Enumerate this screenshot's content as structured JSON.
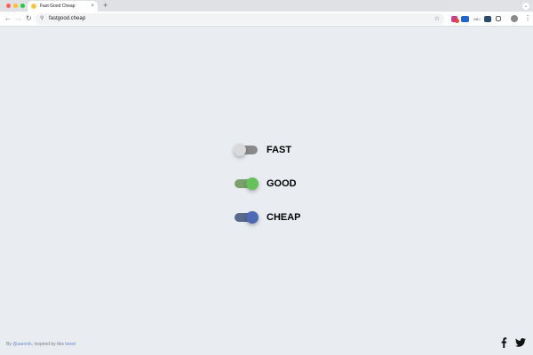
{
  "browser": {
    "tab": {
      "title": "Fast Good Cheap",
      "close_glyph": "×",
      "favicon": "smiley-face-favicon"
    },
    "new_tab_glyph": "+",
    "tab_menu_glyph": "⌄",
    "toolbar": {
      "back_glyph": "←",
      "forward_glyph": "→",
      "reload_glyph": "↻",
      "site_info_glyph": "⚲",
      "url": "fastgood.cheap",
      "bookmark_glyph": "☆",
      "ext_3_text": "ABC",
      "kebab_glyph": "⋮"
    }
  },
  "toggles": [
    {
      "label": "FAST",
      "checked": false,
      "track_color": "#8a8a8a",
      "knob_color": "#d9d9d9"
    },
    {
      "label": "GOOD",
      "checked": true,
      "track_color": "#7ba06e",
      "knob_color": "#65c25a"
    },
    {
      "label": "CHEAP",
      "checked": true,
      "track_color": "#5a6a8c",
      "knob_color": "#4e6ab4"
    }
  ],
  "footer": {
    "credit_prefix": "By ",
    "author_link": "@aaronik",
    "credit_middle": ", inspired by this ",
    "tweet_link": "tweet",
    "social_icons": [
      "facebook-icon",
      "twitter-icon"
    ]
  },
  "colors": {
    "page_background": "#e9edf1",
    "link": "#6b8fc7"
  }
}
